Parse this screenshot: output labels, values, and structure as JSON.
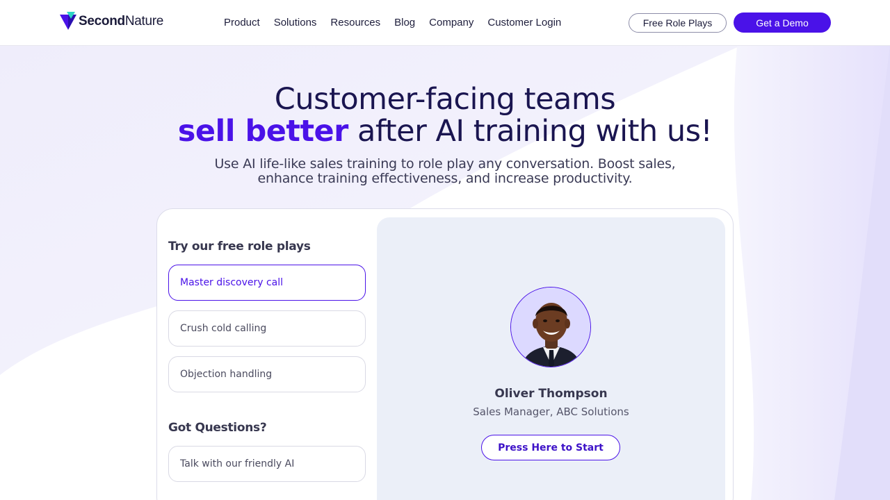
{
  "brand": {
    "name_bold": "Second",
    "name_regular": "Nature"
  },
  "nav": {
    "items": [
      "Product",
      "Solutions",
      "Resources",
      "Blog",
      "Company",
      "Customer Login"
    ]
  },
  "header_actions": {
    "free_role_plays": "Free Role Plays",
    "get_demo": "Get a Demo"
  },
  "hero": {
    "line1": "Customer-facing teams",
    "line2_accent": "sell better",
    "line2_rest": " after AI training with us!",
    "subtitle_line1": "Use AI life-like sales training to role play any conversation. Boost sales,",
    "subtitle_line2": "enhance training effectiveness, and increase productivity."
  },
  "roleplays": {
    "title": "Try our free role plays",
    "options": [
      "Master discovery call",
      "Crush cold calling",
      "Objection handling"
    ],
    "selected_index": 0
  },
  "questions": {
    "title": "Got Questions?",
    "option": "Talk with our friendly AI"
  },
  "persona": {
    "name": "Oliver Thompson",
    "role": "Sales Manager, ABC Solutions",
    "cta": "Press Here to Start"
  },
  "colors": {
    "accent": "#4a12e8",
    "heading": "#1a1550",
    "panel": "#ebeff8"
  },
  "icons": {
    "logo": "secondnature-logo-icon",
    "avatar": "person-avatar"
  }
}
